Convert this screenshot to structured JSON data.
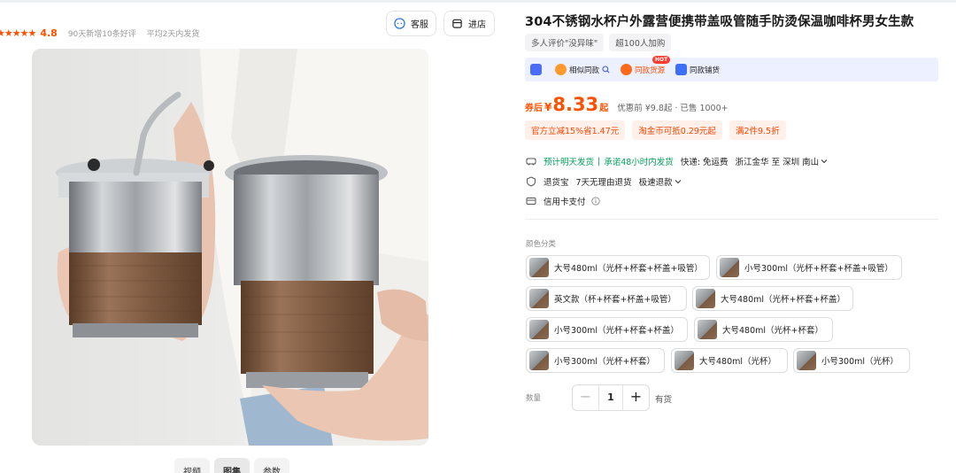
{
  "header": {
    "stars": "★★★★★",
    "rating": "4.8",
    "reviews_meta": "90天新增10条好评",
    "ship_meta": "平均2天内发货",
    "service_label": "客服",
    "shop_label": "进店"
  },
  "gallery": {
    "tabs": [
      "视频",
      "图集",
      "参数"
    ],
    "active_tab": "图集"
  },
  "product": {
    "title": "304不锈钢水杯户外露营便携带盖吸管随手防烫保温咖啡杯男女生款",
    "tags": [
      "多人评价\"没异味\"",
      "超100人加购"
    ],
    "promo": {
      "item1": "相似同款",
      "item2": "同款货源",
      "hot_badge": "HOT",
      "item3": "同款铺货"
    },
    "price": {
      "prefix": "券后",
      "currency": "¥",
      "value": "8.33",
      "suffix": "起",
      "original": "优惠前 ¥9.8起 · 已售 1000+"
    },
    "coupons": [
      "官方立减15%省1.47元",
      "淘金币可抵0.29元起",
      "满2件9.5折"
    ],
    "shipping": {
      "eta": "预计明天发货",
      "sep": "|",
      "promise": "承诺48小时内发货",
      "fee": "快递: 免运费",
      "route": "浙江金华 至 深圳 南山"
    },
    "returns": {
      "label": "退货宝",
      "policy": "7天无理由退货",
      "fast": "极速退款"
    },
    "payment": {
      "label": "信用卡支付"
    },
    "color_label": "颜色分类",
    "options": [
      "大号480ml（光杯+杯套+杯盖+吸管）",
      "小号300ml（光杯+杯套+杯盖+吸管）",
      "英文款（杯+杯套+杯盖+吸管）",
      "大号480ml（光杯+杯套+杯盖）",
      "小号300ml（光杯+杯套+杯盖）",
      "大号480ml（光杯+杯套）",
      "小号300ml（光杯+杯套）",
      "大号480ml（光杯）",
      "小号300ml（光杯）"
    ],
    "quantity_label": "数量",
    "quantity": "1",
    "minus": "−",
    "plus": "+",
    "stock": "有货"
  },
  "colors": {
    "accent": "#ff5000",
    "green": "#00a05a",
    "promo_bg": "#edf1ff"
  }
}
